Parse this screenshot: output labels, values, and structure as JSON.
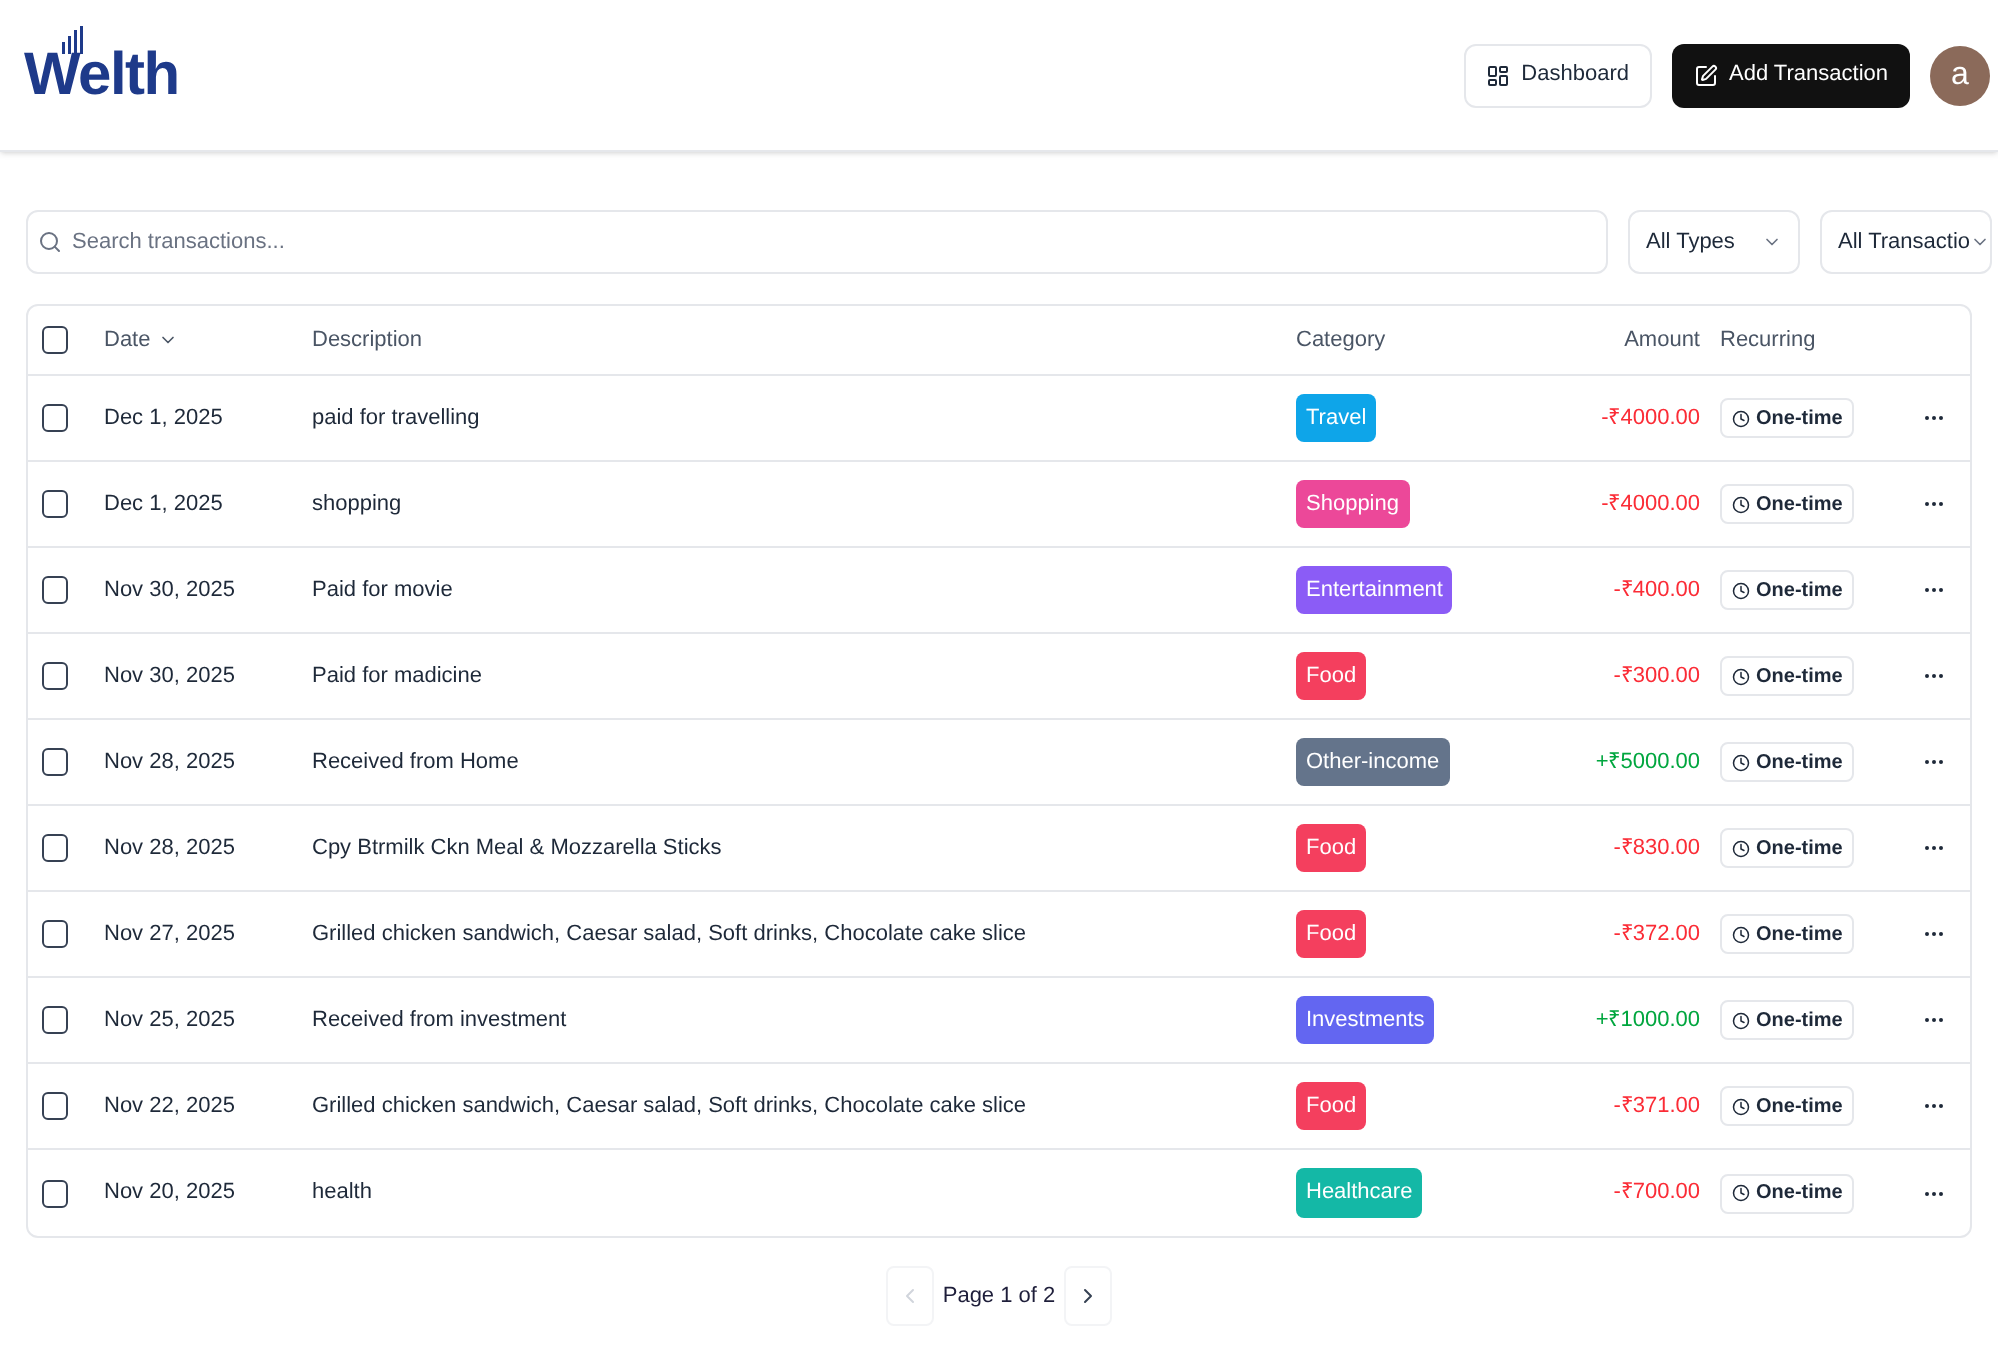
{
  "header": {
    "logo": "Welth",
    "buttons": [
      {
        "label": "Dashboard",
        "kind": "outline"
      },
      {
        "label": "Add Transaction",
        "kind": "primary"
      }
    ],
    "avatar": "a"
  },
  "filters": {
    "search": {
      "placeholder": "Search transactions..."
    },
    "selects": [
      "All Types",
      "All Transactio"
    ]
  },
  "table": {
    "select_all_checked": false,
    "columns": [
      "Date",
      "Description",
      "Category",
      "Amount",
      "Recurring"
    ],
    "rows": [
      {
        "checked": false,
        "date": "Dec 1, 2025",
        "description": "paid for travelling",
        "category": "Travel",
        "color": "#0ea5e9",
        "amount": "-₹4000.00",
        "kind": "expense",
        "recurring": "One-time"
      },
      {
        "checked": false,
        "date": "Dec 1, 2025",
        "description": "shopping",
        "category": "Shopping",
        "color": "#ec4899",
        "amount": "-₹4000.00",
        "kind": "expense",
        "recurring": "One-time"
      },
      {
        "checked": false,
        "date": "Nov 30, 2025",
        "description": "Paid for movie",
        "category": "Entertainment",
        "color": "#8b5cf6",
        "amount": "-₹400.00",
        "kind": "expense",
        "recurring": "One-time"
      },
      {
        "checked": false,
        "date": "Nov 30, 2025",
        "description": "Paid for madicine",
        "category": "Food",
        "color": "#f43f5e",
        "amount": "-₹300.00",
        "kind": "expense",
        "recurring": "One-time"
      },
      {
        "checked": false,
        "date": "Nov 28, 2025",
        "description": "Received from Home",
        "category": "Other-income",
        "color": "#64748b",
        "amount": "+₹5000.00",
        "kind": "income",
        "recurring": "One-time"
      },
      {
        "checked": false,
        "date": "Nov 28, 2025",
        "description": "Cpy Btrmilk Ckn Meal & Mozzarella Sticks",
        "category": "Food",
        "color": "#f43f5e",
        "amount": "-₹830.00",
        "kind": "expense",
        "recurring": "One-time"
      },
      {
        "checked": false,
        "date": "Nov 27, 2025",
        "description": "Grilled chicken sandwich, Caesar salad, Soft drinks, Chocolate cake slice",
        "category": "Food",
        "color": "#f43f5e",
        "amount": "-₹372.00",
        "kind": "expense",
        "recurring": "One-time"
      },
      {
        "checked": false,
        "date": "Nov 25, 2025",
        "description": "Received from investment",
        "category": "Investments",
        "color": "#6366f1",
        "amount": "+₹1000.00",
        "kind": "income",
        "recurring": "One-time"
      },
      {
        "checked": false,
        "date": "Nov 22, 2025",
        "description": "Grilled chicken sandwich, Caesar salad, Soft drinks, Chocolate cake slice",
        "category": "Food",
        "color": "#f43f5e",
        "amount": "-₹371.00",
        "kind": "expense",
        "recurring": "One-time"
      },
      {
        "checked": false,
        "date": "Nov 20, 2025",
        "description": "health",
        "category": "Healthcare",
        "color": "#14b8a6",
        "amount": "-₹700.00",
        "kind": "expense",
        "recurring": "One-time"
      }
    ]
  },
  "pagination": {
    "label": "Page 1 of 2",
    "prev_disabled": true,
    "next_disabled": false
  }
}
